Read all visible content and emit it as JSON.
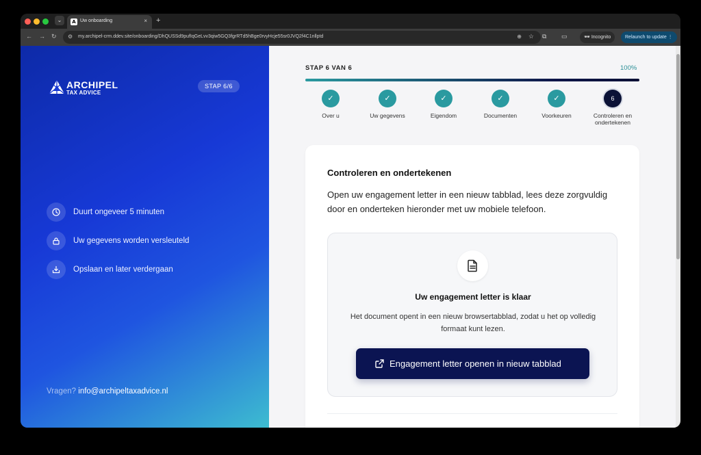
{
  "browser": {
    "tab_title": "Uw onboarding",
    "tab_favicon": "A",
    "new_tab": "+",
    "close_tab": "×",
    "url": "my.archipel-crm.ddev.site/onboarding/DhQUSSd9pufIqGeLvv3qiw5GQ3fgrRTd5hBge0rvyHcje55sr0JVQ2f4C1nllptd",
    "incognito_label": "Incognito",
    "relaunch_label": "Relaunch to update"
  },
  "sidebar": {
    "logo_name": "ARCHIPEL",
    "logo_sub": "TAX ADVICE",
    "step_badge": "STAP 6/6",
    "features": [
      {
        "label": "Duurt ongeveer 5 minuten",
        "icon": "clock-icon"
      },
      {
        "label": "Uw gegevens worden versleuteld",
        "icon": "lock-icon"
      },
      {
        "label": "Opslaan en later verdergaan",
        "icon": "save-icon"
      }
    ],
    "questions_label": "Vragen?",
    "email": "info@archipeltaxadvice.nl"
  },
  "progress": {
    "step_label": "STAP 6 VAN 6",
    "percent_label": "100%",
    "percent": 100,
    "steps": [
      {
        "label": "Over u",
        "status": "done",
        "mark": "✓"
      },
      {
        "label": "Uw gegevens",
        "status": "done",
        "mark": "✓"
      },
      {
        "label": "Eigendom",
        "status": "done",
        "mark": "✓"
      },
      {
        "label": "Documenten",
        "status": "done",
        "mark": "✓"
      },
      {
        "label": "Voorkeuren",
        "status": "done",
        "mark": "✓"
      },
      {
        "label": "Controleren en ondertekenen",
        "status": "current",
        "mark": "6"
      }
    ]
  },
  "card": {
    "heading": "Controleren en ondertekenen",
    "intro": "Open uw engagement letter in een nieuw tabblad, lees deze zorgvuldig door en onderteken hieronder met uw mobiele telefoon.",
    "letter_title": "Uw engagement letter is klaar",
    "letter_desc": "Het document opent in een nieuw browsertabblad, zodat u het op volledig formaat kunt lezen.",
    "open_button": "Engagement letter openen in nieuw tabblad"
  },
  "colors": {
    "accent_teal": "#2a9aa0",
    "navy": "#0b1452",
    "sidebar_blue": "#1739d6"
  }
}
